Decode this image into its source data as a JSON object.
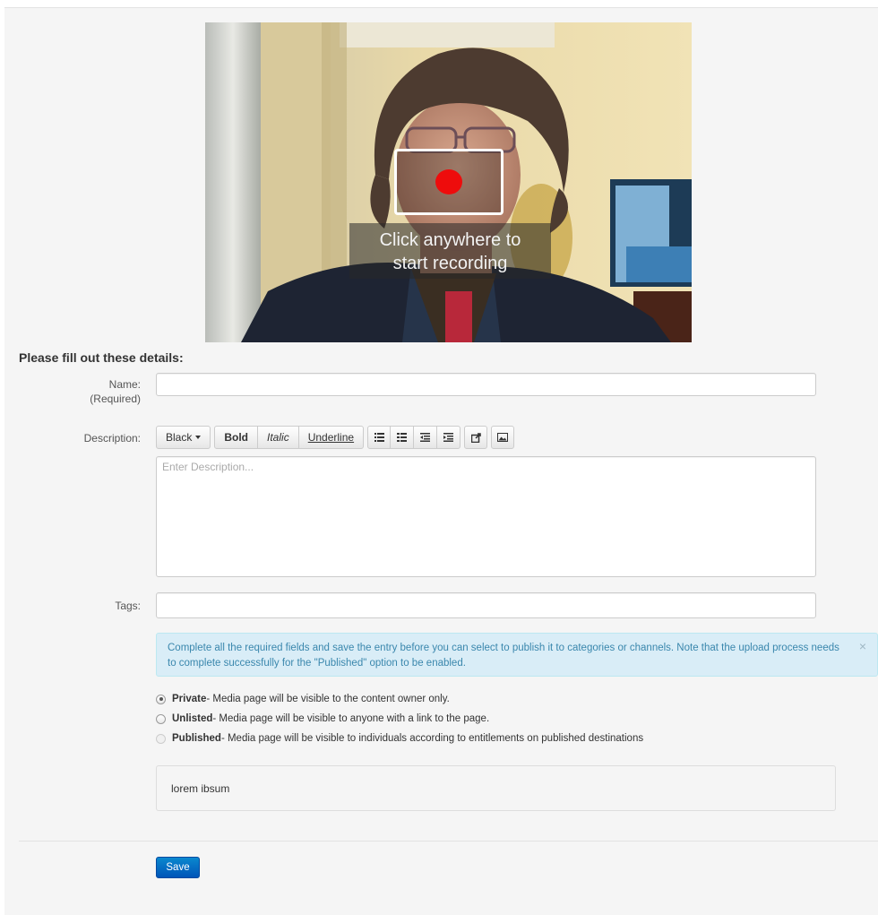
{
  "webcam": {
    "caption_line1": "Click anywhere to",
    "caption_line2": "start recording",
    "record_color": "#ee0c0c"
  },
  "form": {
    "heading": "Please fill out these details:",
    "name": {
      "label": "Name:",
      "sublabel": "(Required)",
      "value": ""
    },
    "description": {
      "label": "Description:",
      "placeholder": "Enter Description...",
      "value": ""
    },
    "tags": {
      "label": "Tags:",
      "value": ""
    }
  },
  "toolbar": {
    "font_color": "Black",
    "bold": "Bold",
    "italic": "Italic",
    "underline": "Underline",
    "icons": [
      "unordered-list-icon",
      "ordered-list-icon",
      "outdent-icon",
      "indent-icon",
      "link-share-icon",
      "image-icon"
    ]
  },
  "alert": {
    "text": "Complete all the required fields and save the entry before you can select to publish it to categories or channels. Note that the upload process needs to complete successfully for the \"Published\" option to be enabled.",
    "close": "×",
    "color": "#d9edf7"
  },
  "privacy": {
    "options": [
      {
        "label": "Private",
        "desc": " - Media page will be visible to the content owner only.",
        "checked": true,
        "disabled": false
      },
      {
        "label": "Unlisted",
        "desc": " - Media page will be visible to anyone with a link to the page.",
        "checked": false,
        "disabled": false
      },
      {
        "label": "Published",
        "desc": " - Media page will be visible to individuals according to entitlements on published destinations",
        "checked": false,
        "disabled": true
      }
    ]
  },
  "note": {
    "text": "lorem ibsum"
  },
  "actions": {
    "save_label": "Save",
    "save_color": "#0a6fc8"
  }
}
